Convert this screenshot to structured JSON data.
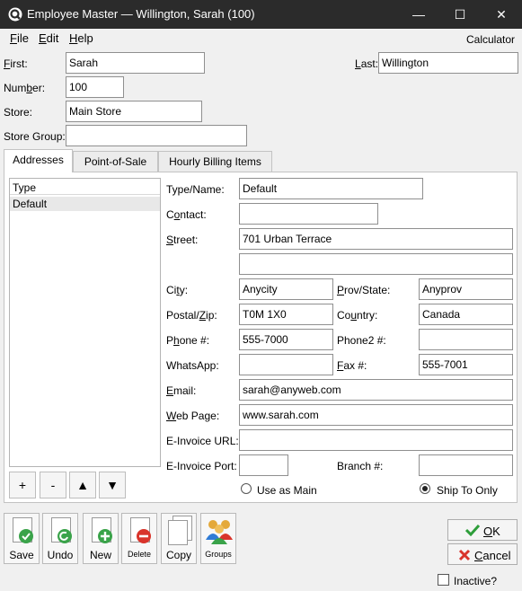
{
  "window": {
    "title": "Employee Master — Willington, Sarah (100)",
    "minimize_glyph": "—",
    "maximize_glyph": "☐",
    "close_glyph": "✕"
  },
  "menu": {
    "file_u": "F",
    "file_rest": "ile",
    "edit_u": "E",
    "edit_rest": "dit",
    "help_u": "H",
    "help_rest": "elp",
    "calculator": "Calculator"
  },
  "header": {
    "first_u": "F",
    "first_rest": "irst:",
    "first_value": "Sarah",
    "last_u": "L",
    "last_rest": "ast:",
    "last_value": "Willington",
    "number_a": "Num",
    "number_u": "b",
    "number_b": "er:",
    "number_value": "100",
    "store_label": "Store:",
    "store_value": "Main Store",
    "store_group_label": "Store Group:",
    "store_group_value": ""
  },
  "tabs": [
    {
      "label": "Addresses",
      "active": true
    },
    {
      "label": "Point-of-Sale",
      "active": false
    },
    {
      "label": "Hourly Billing Items",
      "active": false
    }
  ],
  "address_list": {
    "column_header": "Type",
    "rows": [
      "Default"
    ]
  },
  "list_buttons": {
    "add": "+",
    "remove": "-",
    "up": "▲",
    "down": "▼"
  },
  "address_form": {
    "type_name_label": "Type/Name:",
    "type_name_value": "Default",
    "contact_a": "C",
    "contact_u": "o",
    "contact_b": "ntact:",
    "contact_value": "",
    "street_u": "S",
    "street_rest": "treet:",
    "street_value_1": "701 Urban Terrace",
    "street_value_2": "",
    "city_a": "Ci",
    "city_u": "t",
    "city_b": "y:",
    "city_value": "Anycity",
    "prov_u": "P",
    "prov_rest": "rov/State:",
    "prov_value": "Anyprov",
    "postal_a": "Postal/",
    "postal_u": "Z",
    "postal_b": "ip:",
    "postal_value": "T0M 1X0",
    "country_a": "Co",
    "country_u": "u",
    "country_b": "ntry:",
    "country_value": "Canada",
    "phone_a": "P",
    "phone_u": "h",
    "phone_b": "one #:",
    "phone_value": "555-7000",
    "phone2_label": "Phone2 #:",
    "phone2_value": "",
    "whatsapp_label": "WhatsApp:",
    "whatsapp_value": "",
    "fax_u": "F",
    "fax_rest": "ax #:",
    "fax_value": "555-7001",
    "email_u": "E",
    "email_rest": "mail:",
    "email_value": "sarah@anyweb.com",
    "web_u": "W",
    "web_rest": "eb Page:",
    "web_value": "www.sarah.com",
    "einvoice_url_label": "E-Invoice URL:",
    "einvoice_url_value": "",
    "einvoice_port_label": "E-Invoice Port:",
    "einvoice_port_value": "",
    "branch_label": "Branch #:",
    "branch_value": "",
    "use_as_main_label": "Use as Main",
    "use_as_main_checked": false,
    "ship_to_only_label": "Ship To Only",
    "ship_to_only_checked": true
  },
  "toolbar": {
    "save": "Save",
    "undo": "Undo",
    "new": "New",
    "delete": "Delete",
    "copy": "Copy",
    "groups": "Groups"
  },
  "actions": {
    "ok_u": "O",
    "ok_rest": "K",
    "cancel_u": "C",
    "cancel_rest": "ancel",
    "inactive_label": "Inactive?",
    "inactive_checked": false
  },
  "colors": {
    "titlebar": "#2b2b2b",
    "save_green": "#3aa34a",
    "delete_red": "#d9342b",
    "ok_check": "#2e9e3a",
    "cancel_x": "#d9342b"
  }
}
